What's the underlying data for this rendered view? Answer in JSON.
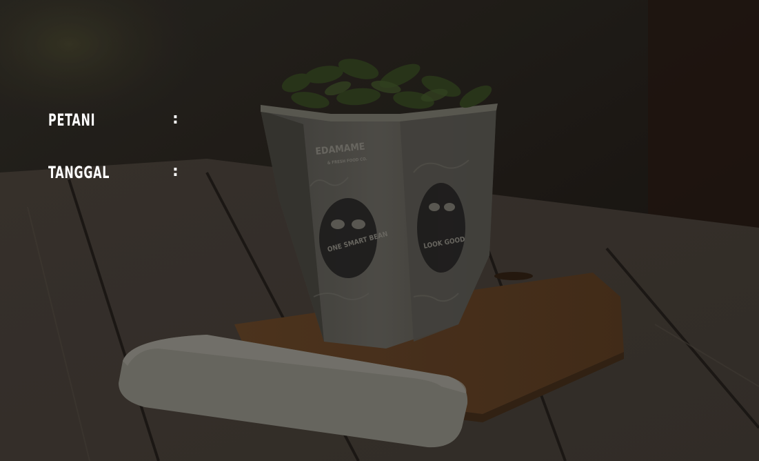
{
  "background": {
    "description_icon": "edamame-cup-photo",
    "overlay_color": "#0a0806"
  },
  "info": {
    "rows": [
      {
        "label": "PETANI",
        "separator": ":",
        "value": ""
      },
      {
        "label": "TANGGAL",
        "separator": ":",
        "value": ""
      }
    ]
  },
  "cup": {
    "brand": "EDAMAME",
    "sub_brand": "& FRESH FOOD CO.",
    "mascot_left": "ONE SMART BEAN",
    "mascot_right": "LOOK GOOD"
  }
}
